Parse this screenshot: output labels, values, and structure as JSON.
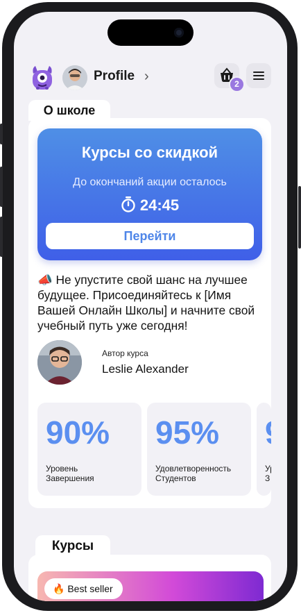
{
  "header": {
    "profile_label": "Profile",
    "chevron": "›",
    "cart_badge": "2",
    "mascot_icon": "purple-monster-mascot",
    "cart_icon": "shopping-basket-icon",
    "menu_icon": "hamburger-menu-icon"
  },
  "about": {
    "tab_label": "О школе",
    "promo": {
      "title": "Курсы со скидкой",
      "subtitle": "До окончаний акции осталось",
      "timer": "24:45",
      "button": "Перейти",
      "gradient": [
        "#4f8fe6",
        "#3f5fe8"
      ]
    },
    "description_emoji": "📣",
    "description": "Не упустите свой шанс на лучшее будущее. Присоединяйтесь к [Имя Вашей Онлайн Школы] и начните свой учебный путь уже сегодня!",
    "author": {
      "caption": "Автор курса",
      "name": "Leslie Alexander"
    },
    "stats": [
      {
        "value": "90%",
        "label_line1": "Уровень",
        "label_line2": "Завершения"
      },
      {
        "value": "95%",
        "label_line1": "Удовлетворенность",
        "label_line2": "Студентов"
      },
      {
        "value": "9",
        "label_line1": "Ур",
        "label_line2": "З"
      }
    ]
  },
  "courses": {
    "tab_label": "Курсы",
    "badge_emoji": "🔥",
    "badge_label": "Best seller"
  },
  "colors": {
    "accent": "#5b8ff0",
    "badge": "#9a78e0",
    "background": "#f2f1f6"
  }
}
